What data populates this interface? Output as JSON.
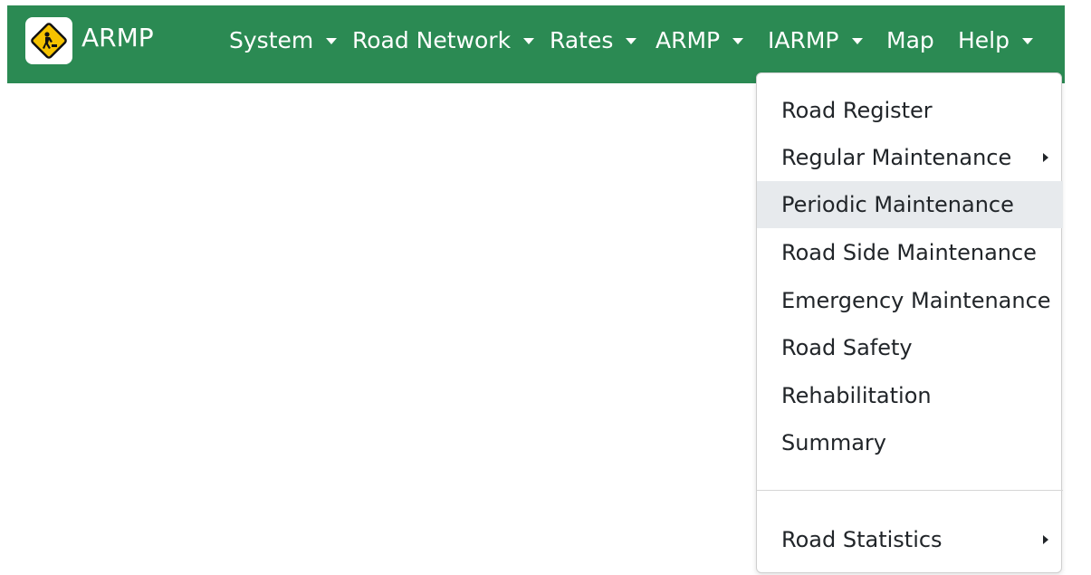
{
  "navbar": {
    "brand": {
      "logo_icon": "road-work-sign-icon",
      "title": "ARMP"
    },
    "color": "#2b8a53",
    "menus": [
      {
        "label": "System",
        "has_dropdown": true
      },
      {
        "label": "Road Network",
        "has_dropdown": true
      },
      {
        "label": "Rates",
        "has_dropdown": true
      },
      {
        "label": "ARMP",
        "has_dropdown": true
      },
      {
        "label": "IARMP",
        "has_dropdown": true
      },
      {
        "label": "Map",
        "has_dropdown": false
      },
      {
        "label": "Help",
        "has_dropdown": true
      }
    ]
  },
  "dropdown": {
    "open_menu": "IARMP",
    "items": [
      {
        "label": "Road Register",
        "has_submenu": false
      },
      {
        "label": "Regular Maintenance",
        "has_submenu": true
      },
      {
        "label": "Periodic Maintenance",
        "has_submenu": false,
        "highlighted": true
      },
      {
        "label": "Road Side Maintenance",
        "has_submenu": false
      },
      {
        "label": "Emergency Maintenance",
        "has_submenu": false
      },
      {
        "label": "Road Safety",
        "has_submenu": false
      },
      {
        "label": "Rehabilitation",
        "has_submenu": false
      },
      {
        "label": "Summary",
        "has_submenu": false
      },
      {
        "label": "Road Statistics",
        "has_submenu": true
      }
    ],
    "highlight_color": "#e7eaed"
  }
}
